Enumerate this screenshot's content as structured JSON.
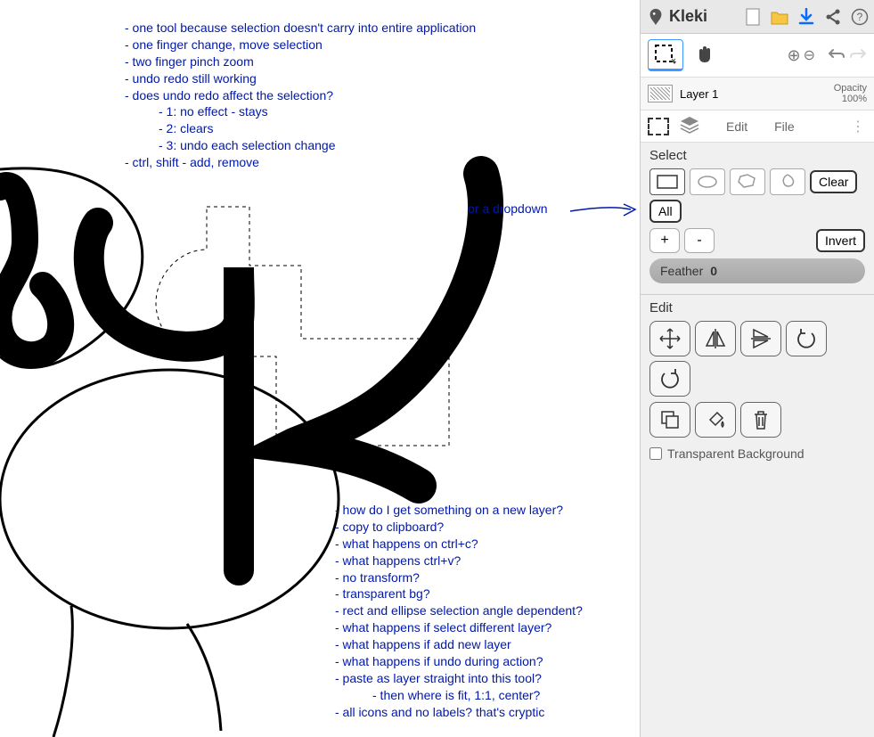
{
  "brand": "Kleki",
  "layer": {
    "name": "Layer 1",
    "opacity_label": "Opacity",
    "opacity_value": "100%"
  },
  "tabs": {
    "edit": "Edit",
    "file": "File"
  },
  "select_section": {
    "title": "Select",
    "clear": "Clear",
    "all": "All",
    "plus": "+",
    "minus": "-",
    "invert": "Invert",
    "feather_label": "Feather",
    "feather_value": "0"
  },
  "edit_section": {
    "title": "Edit",
    "transparent_bg": "Transparent Background"
  },
  "annot_top": [
    "- one tool because selection doesn't carry into entire application",
    "- one finger change, move selection",
    "- two finger pinch zoom",
    "- undo redo still working",
    "- does undo redo affect the selection?",
    "- 1: no effect - stays",
    "- 2: clears",
    "- 3: undo each selection change",
    "- ctrl, shift - add, remove"
  ],
  "annot_dropdown": "or a dropdown",
  "annot_bottom": [
    "- how do I get something on a new layer?",
    "- copy to clipboard?",
    "- what happens on ctrl+c?",
    "- what happens ctrl+v?",
    "- no transform?",
    "- transparent bg?",
    "- rect and ellipse selection angle dependent?",
    "- what happens if select different layer?",
    "- what happens if add new layer",
    "- what happens if undo during action?",
    "- paste as layer straight into this tool?",
    "- then where is fit, 1:1, center?",
    "- all icons and no labels? that's cryptic"
  ]
}
